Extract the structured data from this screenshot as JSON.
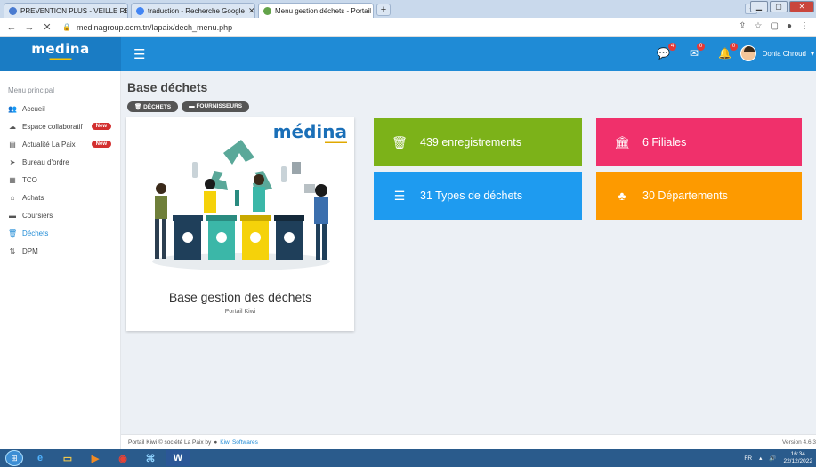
{
  "browser": {
    "tabs": [
      {
        "title": "PREVENTION PLUS - VEILLE REG",
        "fav_color": "#4a7bd0",
        "active": false
      },
      {
        "title": "traduction - Recherche Google",
        "fav_color": "#4285f4",
        "active": false
      },
      {
        "title": "Menu gestion déchets - Portail K",
        "fav_color": "#63a34a",
        "active": true
      }
    ],
    "new_tab": "+",
    "url": "medinagroup.com.tn/lapaix/dech_menu.php"
  },
  "header": {
    "logo": "medina",
    "notifications": [
      {
        "icon": "chat-icon",
        "count": "4"
      },
      {
        "icon": "mail-icon",
        "count": "0"
      },
      {
        "icon": "bell-icon",
        "count": "0"
      }
    ],
    "user_name": "Donia Chroud"
  },
  "sidebar": {
    "title": "Menu principal",
    "items": [
      {
        "label": "Accueil",
        "icon": "users-icon",
        "glyph": "👥",
        "badge": ""
      },
      {
        "label": "Espace collaboratif",
        "icon": "cloud-icon",
        "glyph": "☁",
        "badge": "New"
      },
      {
        "label": "Actualité La Paix",
        "icon": "newspaper-icon",
        "glyph": "▤",
        "badge": "New"
      },
      {
        "label": "Bureau d'ordre",
        "icon": "send-icon",
        "glyph": "➤",
        "badge": ""
      },
      {
        "label": "TCO",
        "icon": "table-icon",
        "glyph": "▦",
        "badge": ""
      },
      {
        "label": "Achats",
        "icon": "building-icon",
        "glyph": "⌂",
        "badge": ""
      },
      {
        "label": "Coursiers",
        "icon": "truck-icon",
        "glyph": "▬",
        "badge": ""
      },
      {
        "label": "Déchets",
        "icon": "trash-icon",
        "glyph": "🗑",
        "badge": "",
        "active": true
      },
      {
        "label": "DPM",
        "icon": "sort-icon",
        "glyph": "⇅",
        "badge": ""
      }
    ]
  },
  "main": {
    "title": "Base déchets",
    "pills": [
      "DÉCHETS",
      "FOURNISSEURS"
    ],
    "card": {
      "logo": "médina",
      "title": "Base gestion des déchets",
      "subtitle": "Portail Kiwi"
    },
    "stats": [
      {
        "label": "439 enregistrements",
        "icon": "trash-icon",
        "glyph": "🗑",
        "color": "#7cb219"
      },
      {
        "label": "6 Filiales",
        "icon": "bank-icon",
        "glyph": "🏛",
        "color": "#f0306b"
      },
      {
        "label": "31 Types de déchets",
        "icon": "list-icon",
        "glyph": "☰",
        "color": "#1e9bf0"
      },
      {
        "label": "30 Départements",
        "icon": "sitemap-icon",
        "glyph": "♣",
        "color": "#fd9a00"
      }
    ]
  },
  "footer": {
    "text": "Portail Kiwi © société La Paix by",
    "link": "Kiwi Softwares",
    "version": "Version 4.6.3"
  },
  "taskbar": {
    "lang": "FR",
    "time": "16:34",
    "date": "22/12/2022"
  }
}
